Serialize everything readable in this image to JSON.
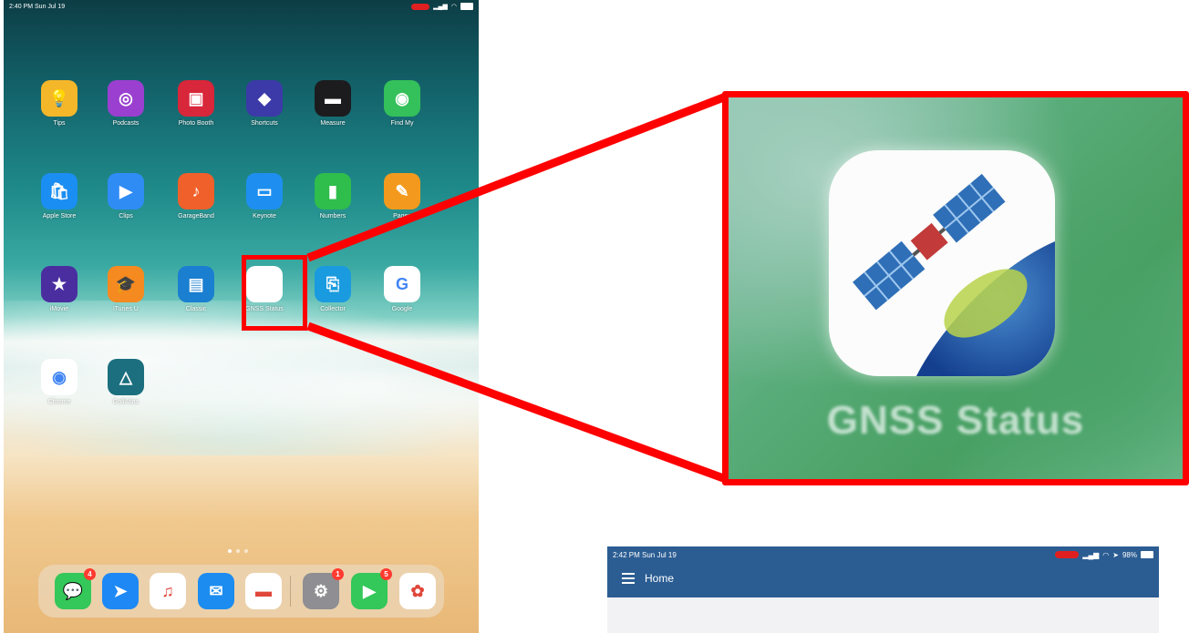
{
  "home_screen": {
    "status_time": "2:40 PM  Sun Jul 19",
    "apps": [
      {
        "label": "Tips",
        "color": "#f5b72a",
        "glyph": "💡"
      },
      {
        "label": "Podcasts",
        "color": "#9a3fd0",
        "glyph": "◎"
      },
      {
        "label": "Photo Booth",
        "color": "#d8263a",
        "glyph": "▣"
      },
      {
        "label": "Shortcuts",
        "color": "#3c3aa8",
        "glyph": "◆"
      },
      {
        "label": "Measure",
        "color": "#1c1c1e",
        "glyph": "▬"
      },
      {
        "label": "Find My",
        "color": "#34c05a",
        "glyph": "◉"
      },
      {
        "label": "Apple Store",
        "color": "#1a8ef2",
        "glyph": "🛍"
      },
      {
        "label": "Clips",
        "color": "#2f8cf5",
        "glyph": "▶"
      },
      {
        "label": "GarageBand",
        "color": "#f0602a",
        "glyph": "♪"
      },
      {
        "label": "Keynote",
        "color": "#1e8ff0",
        "glyph": "▭"
      },
      {
        "label": "Numbers",
        "color": "#2fbd4b",
        "glyph": "▮"
      },
      {
        "label": "Pages",
        "color": "#f39a1e",
        "glyph": "✎"
      },
      {
        "label": "iMovie",
        "color": "#4a2ea0",
        "glyph": "★"
      },
      {
        "label": "iTunes U",
        "color": "#f58a20",
        "glyph": "🎓"
      },
      {
        "label": "Classic",
        "color": "#1a7fd0",
        "glyph": "▤"
      },
      {
        "label": "GNSS Status",
        "color": "#ffffff",
        "glyph": ""
      },
      {
        "label": "Collector",
        "color": "#1a9be0",
        "glyph": "⎘"
      },
      {
        "label": "Google",
        "color": "#ffffff",
        "glyph": "G"
      },
      {
        "label": "Chrome",
        "color": "#ffffff",
        "glyph": "◉"
      },
      {
        "label": "GolfAtlas",
        "color": "#1b6f7e",
        "glyph": "△"
      }
    ],
    "dock": [
      {
        "label": "Messages",
        "color": "#34c759",
        "glyph": "💬",
        "badge": "4"
      },
      {
        "label": "Safari",
        "color": "#1e88f5",
        "glyph": "➤",
        "badge": ""
      },
      {
        "label": "Music",
        "color": "#ffffff",
        "glyph": "♫",
        "badge": ""
      },
      {
        "label": "Mail",
        "color": "#1c8cf0",
        "glyph": "✉",
        "badge": ""
      },
      {
        "label": "Files",
        "color": "#ffffff",
        "glyph": "▬",
        "badge": ""
      },
      {
        "label": "Settings",
        "color": "#8e8e93",
        "glyph": "⚙",
        "badge": "1"
      },
      {
        "label": "FaceTime",
        "color": "#34c759",
        "glyph": "▶",
        "badge": "5"
      },
      {
        "label": "Photos",
        "color": "#ffffff",
        "glyph": "✿",
        "badge": ""
      }
    ]
  },
  "zoom": {
    "label": "GNSS Status"
  },
  "app_screen": {
    "status_time": "2:42 PM  Sun Jul 19",
    "status_right": "98%",
    "nav_title": "Home"
  },
  "colors": {
    "highlight": "#ff0000",
    "app_header": "#2b5d93"
  }
}
